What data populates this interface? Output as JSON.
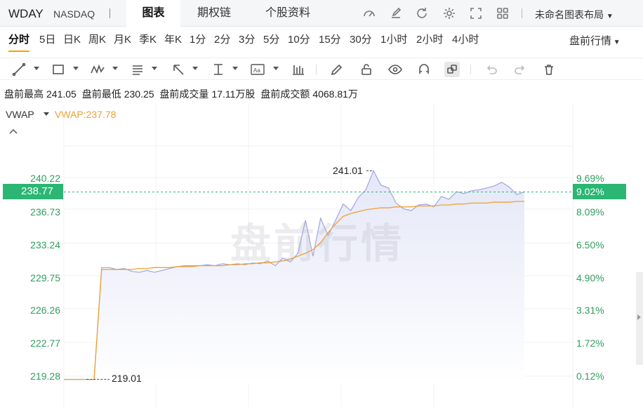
{
  "header": {
    "symbol": "WDAY",
    "exchange": "NASDAQ",
    "tabs": [
      "图表",
      "期权链",
      "个股资料"
    ],
    "layout_name": "未命名图表布局",
    "icons": [
      "gauge-icon",
      "edit-icon",
      "refresh-icon",
      "settings-icon",
      "fullscreen-icon",
      "grid-icon"
    ]
  },
  "periods": [
    "分时",
    "5日",
    "日K",
    "周K",
    "月K",
    "季K",
    "年K",
    "1分",
    "2分",
    "3分",
    "5分",
    "10分",
    "15分",
    "30分",
    "1小时",
    "2小时",
    "4小时"
  ],
  "premarket_selector": "盘前行情",
  "stats": {
    "high_label": "盘前最高",
    "high": "241.05",
    "low_label": "盘前最低",
    "low": "230.25",
    "vol_label": "盘前成交量",
    "vol": "17.11万股",
    "amt_label": "盘前成交额",
    "amt": "4068.81万"
  },
  "indicator": {
    "name": "VWAP",
    "value": "VWAP:237.78"
  },
  "watermark": "盘前行情",
  "colors": {
    "up": "#2bb673",
    "vwap": "#f0a030",
    "price_line": "#9fa6e0",
    "area": "#eef0fa"
  },
  "chart_data": {
    "type": "line",
    "y_ticks": [
      "240.22",
      "236.73",
      "233.24",
      "229.75",
      "226.26",
      "222.77",
      "219.28"
    ],
    "y_pct_ticks": [
      "9.69%",
      "8.09%",
      "6.50%",
      "4.90%",
      "3.31%",
      "1.72%",
      "0.12%"
    ],
    "current_price": "238.77",
    "current_pct": "9.02%",
    "high_marker": "241.01",
    "low_marker": "219.01",
    "ylim": [
      217.5,
      243.0
    ],
    "series": [
      {
        "name": "price",
        "values": [
          219.01,
          219.01,
          219.01,
          219.01,
          219.01,
          230.8,
          230.8,
          230.6,
          230.7,
          230.4,
          230.3,
          230.5,
          230.3,
          230.5,
          230.7,
          230.9,
          231.0,
          231.0,
          231.0,
          231.1,
          231.0,
          231.2,
          231.1,
          231.2,
          231.1,
          231.3,
          231.2,
          231.5,
          231.0,
          231.8,
          231.4,
          232.3,
          235.8,
          232.0,
          236.0,
          234.2,
          235.8,
          237.5,
          236.8,
          238.2,
          239.0,
          241.01,
          239.5,
          239.2,
          237.6,
          237.0,
          236.8,
          237.4,
          237.5,
          237.2,
          238.3,
          238.0,
          238.8,
          238.6,
          238.9,
          239.0,
          239.2,
          239.4,
          239.8,
          239.3,
          238.5,
          238.8
        ],
        "color": "#9fa6e0"
      },
      {
        "name": "VWAP",
        "values": [
          219.01,
          219.01,
          219.01,
          219.01,
          219.01,
          230.6,
          230.6,
          230.6,
          230.6,
          230.6,
          230.7,
          230.7,
          230.8,
          230.8,
          230.8,
          230.9,
          230.9,
          230.9,
          231.0,
          231.0,
          231.0,
          231.0,
          231.1,
          231.1,
          231.2,
          231.2,
          231.3,
          231.3,
          231.4,
          231.5,
          231.7,
          232.0,
          232.3,
          232.7,
          233.4,
          234.5,
          235.4,
          236.2,
          236.5,
          236.7,
          236.9,
          237.0,
          237.1,
          237.1,
          237.2,
          237.2,
          237.2,
          237.3,
          237.3,
          237.3,
          237.4,
          237.4,
          237.5,
          237.5,
          237.6,
          237.6,
          237.6,
          237.7,
          237.7,
          237.7,
          237.78,
          237.78
        ],
        "color": "#f0a030"
      }
    ]
  }
}
